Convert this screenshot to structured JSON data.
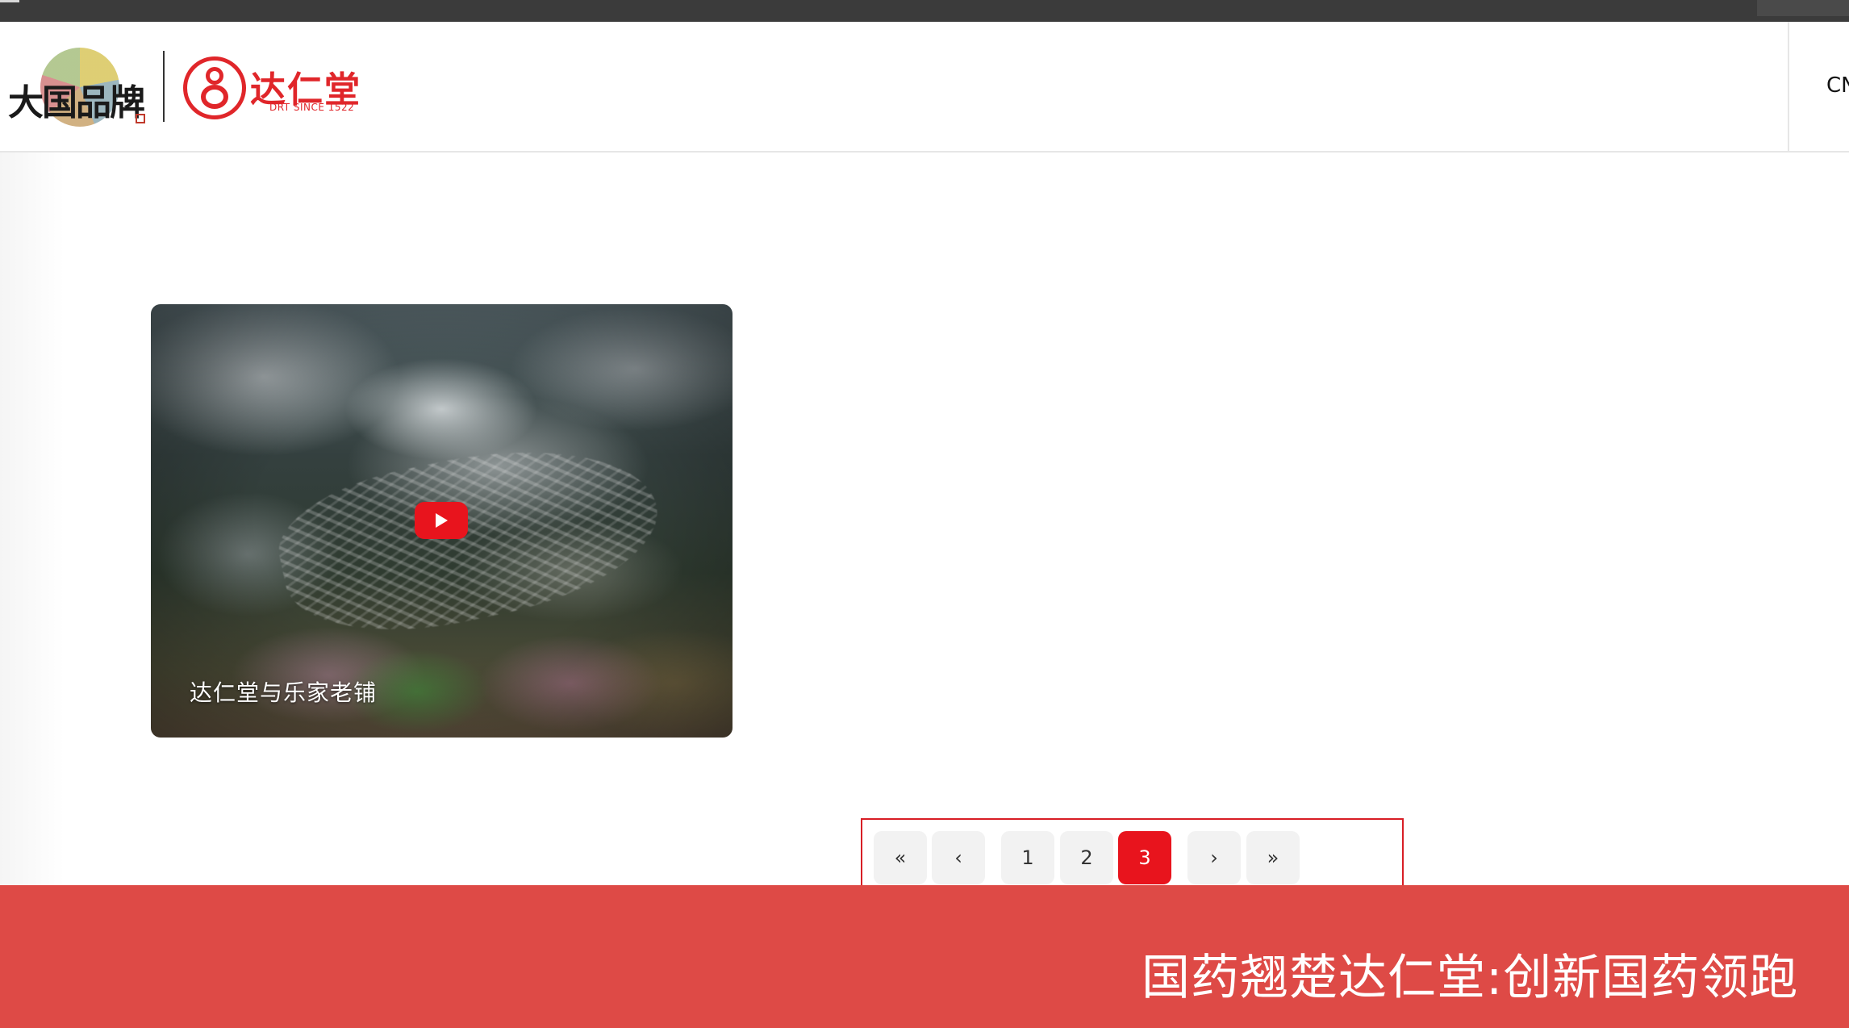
{
  "header": {
    "brand_badge_text": "大国品牌",
    "logo_name": "达仁堂",
    "logo_since": "DRT SINCE 1522",
    "lang": "CN"
  },
  "video": {
    "title": "达仁堂与乐家老铺"
  },
  "pagination": {
    "first_label": "«",
    "prev_label": "‹",
    "pages": [
      "1",
      "2",
      "3"
    ],
    "current_page": "3",
    "next_label": "›",
    "last_label": "»"
  },
  "footer": {
    "ticker_text": "国药翘楚达仁堂:创新国药领跑"
  },
  "colors": {
    "accent": "#e8141d",
    "banner": "#de4a46"
  }
}
